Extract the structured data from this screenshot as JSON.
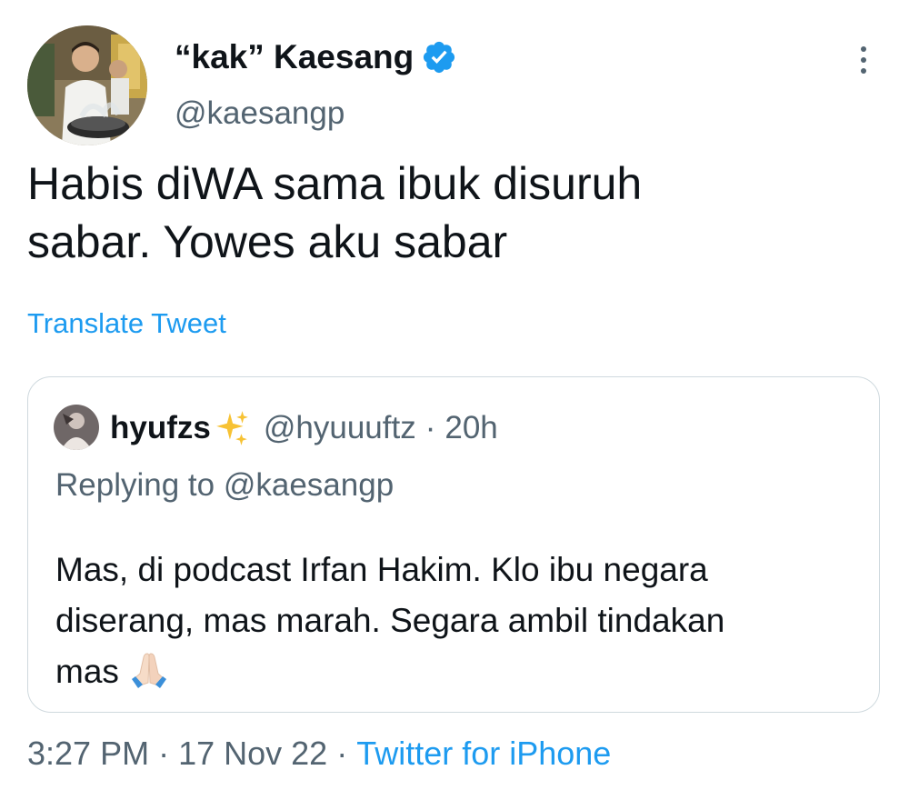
{
  "author": {
    "display_name": "“kak” Kaesang",
    "handle": "@kaesangp",
    "verified_icon": "verified-badge-icon",
    "verified_color": "#1d9bf0"
  },
  "tweet": {
    "text_line1": "Habis diWA sama ibuk disuruh",
    "text_line2": "sabar. Yowes aku sabar",
    "translate_label": "Translate Tweet"
  },
  "quoted": {
    "display_name": "hyufzs",
    "name_emoji_icon": "sparkles-icon",
    "handle": "@hyuuuftz",
    "separator": "·",
    "time": "20h",
    "replying_prefix": "Replying to",
    "replying_to": "@kaesangp",
    "text_line1": "Mas, di podcast Irfan Hakim. Klo ibu negara",
    "text_line2": "diserang, mas marah. Segara ambil tindakan",
    "text_line3": "mas",
    "text_emoji_icon": "folded-hands-icon"
  },
  "meta": {
    "time": "3:27 PM",
    "separator": "·",
    "date": "17 Nov 22",
    "source": "Twitter for iPhone"
  },
  "colors": {
    "text": "#0f1419",
    "secondary": "#536471",
    "link": "#1d9bf0",
    "border": "#cfd9de"
  }
}
